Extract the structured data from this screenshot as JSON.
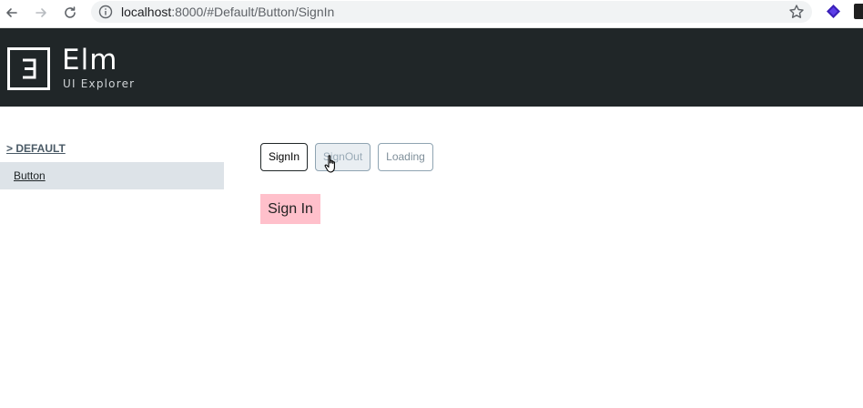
{
  "browser": {
    "url_host": "localhost",
    "url_path": ":8000/#Default/Button/SignIn"
  },
  "header": {
    "logo_title": "Elm",
    "logo_subtitle": "UI Explorer"
  },
  "sidebar": {
    "section_title": "> DEFAULT",
    "items": [
      {
        "label": "Button"
      }
    ]
  },
  "tabs": [
    {
      "label": "SignIn"
    },
    {
      "label": "SignOut"
    },
    {
      "label": "Loading"
    }
  ],
  "preview": {
    "button_label": "Sign In"
  },
  "colors": {
    "header_bg": "#202628",
    "sidebar_active_bg": "#dde3e8",
    "preview_button_bg": "#ffc0cb"
  }
}
